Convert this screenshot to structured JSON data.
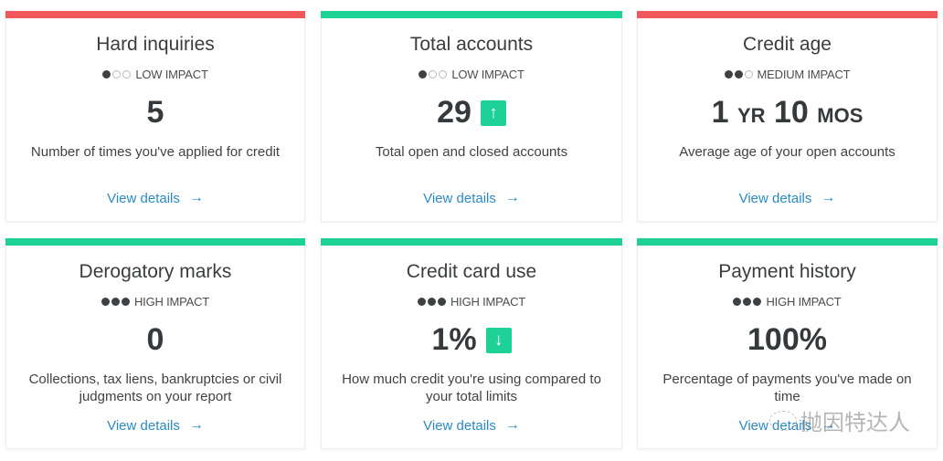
{
  "colors": {
    "negative": "#f0585e",
    "positive": "#1dd197",
    "link": "#2b8ac3"
  },
  "cards": [
    {
      "title": "Hard inquiries",
      "impact_level": 1,
      "impact_label": "LOW IMPACT",
      "value": "5",
      "trend": null,
      "description": "Number of times you've applied for credit",
      "link_label": "View details",
      "status": "negative"
    },
    {
      "title": "Total accounts",
      "impact_level": 1,
      "impact_label": "LOW IMPACT",
      "value": "29",
      "trend": "up",
      "trend_icon": "↑",
      "description": "Total open and closed accounts",
      "link_label": "View details",
      "status": "positive"
    },
    {
      "title": "Credit age",
      "impact_level": 2,
      "impact_label": "MEDIUM IMPACT",
      "value_years": "1",
      "value_years_unit": "YR",
      "value_months": "10",
      "value_months_unit": "MOS",
      "trend": null,
      "description": "Average age of your open accounts",
      "link_label": "View details",
      "status": "negative"
    },
    {
      "title": "Derogatory marks",
      "impact_level": 3,
      "impact_label": "HIGH IMPACT",
      "value": "0",
      "trend": null,
      "description": "Collections, tax liens, bankruptcies or civil judgments on your report",
      "link_label": "View details",
      "status": "positive"
    },
    {
      "title": "Credit card use",
      "impact_level": 3,
      "impact_label": "HIGH IMPACT",
      "value": "1%",
      "trend": "down",
      "trend_icon": "↓",
      "description": "How much credit you're using compared to your total limits",
      "link_label": "View details",
      "status": "positive"
    },
    {
      "title": "Payment history",
      "impact_level": 3,
      "impact_label": "HIGH IMPACT",
      "value": "100%",
      "trend": null,
      "description": "Percentage of payments you've made on time",
      "link_label": "View details",
      "status": "positive"
    }
  ],
  "link_arrow_icon": "→",
  "watermark": {
    "text": "抛因特达人"
  }
}
